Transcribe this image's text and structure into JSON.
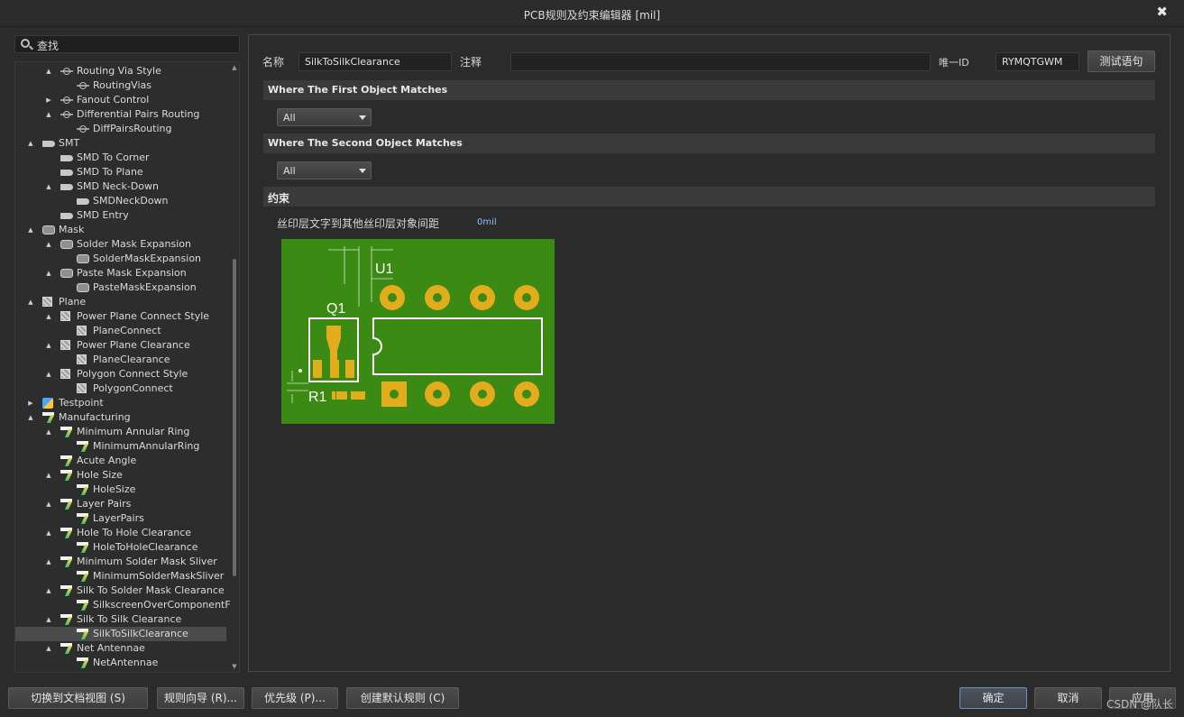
{
  "window": {
    "title": "PCB规则及约束编辑器 [mil]",
    "close_glyph": "✖"
  },
  "search": {
    "label": "查找"
  },
  "tree": {
    "items": [
      {
        "label": "Routing Via Style",
        "level": 1,
        "arrow": "▲",
        "icon": "routing-icon"
      },
      {
        "label": "RoutingVias",
        "level": 2,
        "arrow": "",
        "icon": "routing-icon"
      },
      {
        "label": "Fanout Control",
        "level": 1,
        "arrow": "▶",
        "icon": "routing-icon"
      },
      {
        "label": "Differential Pairs Routing",
        "level": 1,
        "arrow": "▲",
        "icon": "routing-icon"
      },
      {
        "label": "DiffPairsRouting",
        "level": 2,
        "arrow": "",
        "icon": "routing-icon"
      },
      {
        "label": "SMT",
        "level": 0,
        "arrow": "▲",
        "icon": "smt-icon"
      },
      {
        "label": "SMD To Corner",
        "level": 1,
        "arrow": "",
        "icon": "smt-icon"
      },
      {
        "label": "SMD To Plane",
        "level": 1,
        "arrow": "",
        "icon": "smt-icon"
      },
      {
        "label": "SMD Neck-Down",
        "level": 1,
        "arrow": "▲",
        "icon": "smt-icon"
      },
      {
        "label": "SMDNeckDown",
        "level": 2,
        "arrow": "",
        "icon": "smt-icon"
      },
      {
        "label": "SMD Entry",
        "level": 1,
        "arrow": "",
        "icon": "smt-icon"
      },
      {
        "label": "Mask",
        "level": 0,
        "arrow": "▲",
        "icon": "mask-icon"
      },
      {
        "label": "Solder Mask Expansion",
        "level": 1,
        "arrow": "▲",
        "icon": "mask-icon"
      },
      {
        "label": "SolderMaskExpansion",
        "level": 2,
        "arrow": "",
        "icon": "mask-icon"
      },
      {
        "label": "Paste Mask Expansion",
        "level": 1,
        "arrow": "▲",
        "icon": "mask-icon"
      },
      {
        "label": "PasteMaskExpansion",
        "level": 2,
        "arrow": "",
        "icon": "mask-icon"
      },
      {
        "label": "Plane",
        "level": 0,
        "arrow": "▲",
        "icon": "plane-icon"
      },
      {
        "label": "Power Plane Connect Style",
        "level": 1,
        "arrow": "▲",
        "icon": "plane-icon"
      },
      {
        "label": "PlaneConnect",
        "level": 2,
        "arrow": "",
        "icon": "plane-icon"
      },
      {
        "label": "Power Plane Clearance",
        "level": 1,
        "arrow": "▲",
        "icon": "plane-icon"
      },
      {
        "label": "PlaneClearance",
        "level": 2,
        "arrow": "",
        "icon": "plane-icon"
      },
      {
        "label": "Polygon Connect Style",
        "level": 1,
        "arrow": "▲",
        "icon": "plane-icon"
      },
      {
        "label": "PolygonConnect",
        "level": 2,
        "arrow": "",
        "icon": "plane-icon"
      },
      {
        "label": "Testpoint",
        "level": 0,
        "arrow": "▶",
        "icon": "testpoint-icon"
      },
      {
        "label": "Manufacturing",
        "level": 0,
        "arrow": "▲",
        "icon": "manufacturing-icon"
      },
      {
        "label": "Minimum Annular Ring",
        "level": 1,
        "arrow": "▲",
        "icon": "manufacturing-icon"
      },
      {
        "label": "MinimumAnnularRing",
        "level": 2,
        "arrow": "",
        "icon": "manufacturing-icon"
      },
      {
        "label": "Acute Angle",
        "level": 1,
        "arrow": "",
        "icon": "manufacturing-icon"
      },
      {
        "label": "Hole Size",
        "level": 1,
        "arrow": "▲",
        "icon": "manufacturing-icon"
      },
      {
        "label": "HoleSize",
        "level": 2,
        "arrow": "",
        "icon": "manufacturing-icon"
      },
      {
        "label": "Layer Pairs",
        "level": 1,
        "arrow": "▲",
        "icon": "manufacturing-icon"
      },
      {
        "label": "LayerPairs",
        "level": 2,
        "arrow": "",
        "icon": "manufacturing-icon"
      },
      {
        "label": "Hole To Hole Clearance",
        "level": 1,
        "arrow": "▲",
        "icon": "manufacturing-icon"
      },
      {
        "label": "HoleToHoleClearance",
        "level": 2,
        "arrow": "",
        "icon": "manufacturing-icon"
      },
      {
        "label": "Minimum Solder Mask Sliver",
        "level": 1,
        "arrow": "▲",
        "icon": "manufacturing-icon"
      },
      {
        "label": "MinimumSolderMaskSliver",
        "level": 2,
        "arrow": "",
        "icon": "manufacturing-icon"
      },
      {
        "label": "Silk To Solder Mask Clearance",
        "level": 1,
        "arrow": "▲",
        "icon": "manufacturing-icon"
      },
      {
        "label": "SilkscreenOverComponentF",
        "level": 2,
        "arrow": "",
        "icon": "manufacturing-icon"
      },
      {
        "label": "Silk To Silk Clearance",
        "level": 1,
        "arrow": "▲",
        "icon": "manufacturing-icon"
      },
      {
        "label": "SilkToSilkClearance",
        "level": 2,
        "arrow": "",
        "icon": "manufacturing-icon",
        "selected": true
      },
      {
        "label": "Net Antennae",
        "level": 1,
        "arrow": "▲",
        "icon": "manufacturing-icon"
      },
      {
        "label": "NetAntennae",
        "level": 2,
        "arrow": "",
        "icon": "manufacturing-icon"
      }
    ]
  },
  "rule": {
    "name_label": "名称",
    "name_value": "SilkToSilkClearance",
    "comment_label": "注释",
    "comment_value": "",
    "uid_label": "唯一ID",
    "uid_value": "RYMQTGWM",
    "test_button": "测试语句"
  },
  "first_match": {
    "title": "Where The First Object Matches",
    "value": "All"
  },
  "second_match": {
    "title": "Where The Second Object Matches",
    "value": "All"
  },
  "constraints": {
    "title": "约束",
    "label": "丝印层文字到其他丝印层对象间距",
    "value": "0mil",
    "diagram": {
      "label_u1": "U1",
      "label_q1": "Q1",
      "label_r1": "R1",
      "board_color": "#3a8a14",
      "pad_color": "#e2ac1c"
    }
  },
  "bottom": {
    "doc_view": "切换到文档视图 (S)",
    "rule_wizard": "规则向导 (R)...",
    "priority": "优先级 (P)...",
    "create_default": "创建默认规则 (C)",
    "ok": "确定",
    "cancel": "取消",
    "apply": "应用"
  },
  "watermark": "CSDN @队长"
}
